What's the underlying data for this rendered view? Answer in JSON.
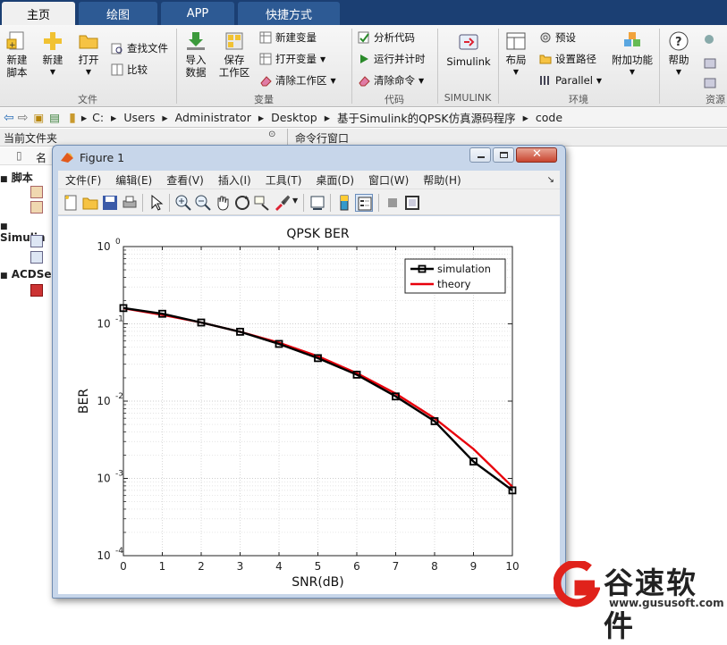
{
  "tabs": [
    "主页",
    "绘图",
    "APP",
    "快捷方式"
  ],
  "ribbon": {
    "file_group": {
      "label": "文件",
      "new_script": "新建\n脚本",
      "new": "新建",
      "open": "打开",
      "find_files": "查找文件",
      "compare": "比较"
    },
    "variable_group": {
      "label": "变量",
      "import_data": "导入\n数据",
      "save_workspace": "保存\n工作区",
      "new_variable": "新建变量",
      "open_variable": "打开变量",
      "clear_workspace": "清除工作区"
    },
    "code_group": {
      "label": "代码",
      "analyze_code": "分析代码",
      "run_and_time": "运行并计时",
      "clear_commands": "清除命令"
    },
    "simulink_group": {
      "label": "SIMULINK",
      "simulink": "Simulink"
    },
    "environment_group": {
      "label": "环境",
      "layout": "布局",
      "preferences": "预设",
      "set_path": "设置路径",
      "parallel": "Parallel",
      "add_ons": "附加功能"
    },
    "resources_group": {
      "label": "资源",
      "help": "帮助"
    }
  },
  "address": {
    "segments": [
      "C:",
      "Users",
      "Administrator",
      "Desktop",
      "基于Simulink的QPSK仿真源码程序",
      "code"
    ]
  },
  "panels": {
    "current_folder": "当前文件夹",
    "command_window": "命令行窗口",
    "name_col": "名"
  },
  "tree": {
    "groups": [
      {
        "label": "脚本"
      },
      {
        "label": "Simulin"
      },
      {
        "label": "ACDSe"
      }
    ]
  },
  "figure": {
    "title": "Figure 1",
    "menus": [
      "文件(F)",
      "编辑(E)",
      "查看(V)",
      "插入(I)",
      "工具(T)",
      "桌面(D)",
      "窗口(W)",
      "帮助(H)"
    ]
  },
  "chart_data": {
    "type": "line",
    "title": "QPSK BER",
    "xlabel": "SNR(dB)",
    "ylabel": "BER",
    "yscale": "log",
    "xlim": [
      0,
      10
    ],
    "ylim": [
      0.0001,
      1
    ],
    "xticks": [
      0,
      1,
      2,
      3,
      4,
      5,
      6,
      7,
      8,
      9,
      10
    ],
    "yticks": [
      {
        "value": 1,
        "mantissa": "10",
        "exp": "0"
      },
      {
        "value": 0.1,
        "mantissa": "10",
        "exp": "-1"
      },
      {
        "value": 0.01,
        "mantissa": "10",
        "exp": "-2"
      },
      {
        "value": 0.001,
        "mantissa": "10",
        "exp": "-3"
      },
      {
        "value": 0.0001,
        "mantissa": "10",
        "exp": "-4"
      }
    ],
    "grid": true,
    "legend_position": "top-right",
    "series": [
      {
        "name": "simulation",
        "color": "#000000",
        "marker": "square",
        "x": [
          0,
          1,
          2,
          3,
          4,
          5,
          6,
          7,
          8,
          9,
          10
        ],
        "y": [
          0.16,
          0.135,
          0.104,
          0.079,
          0.055,
          0.036,
          0.022,
          0.0115,
          0.0055,
          0.00165,
          0.0007
        ]
      },
      {
        "name": "theory",
        "color": "#e8000b",
        "marker": "none",
        "x": [
          0,
          1,
          2,
          3,
          4,
          5,
          6,
          7,
          8,
          9,
          10
        ],
        "y": [
          0.159,
          0.131,
          0.104,
          0.079,
          0.057,
          0.038,
          0.023,
          0.0125,
          0.006,
          0.0024,
          0.00078
        ]
      }
    ]
  },
  "watermark": {
    "brand": "谷速软件",
    "url": "www.gususoft.com"
  },
  "colors": {
    "tabbar": "#1b3f73",
    "figure_frame": "#c7d6ea",
    "theory_line": "#e8000b",
    "watermark_red": "#e0221b"
  }
}
